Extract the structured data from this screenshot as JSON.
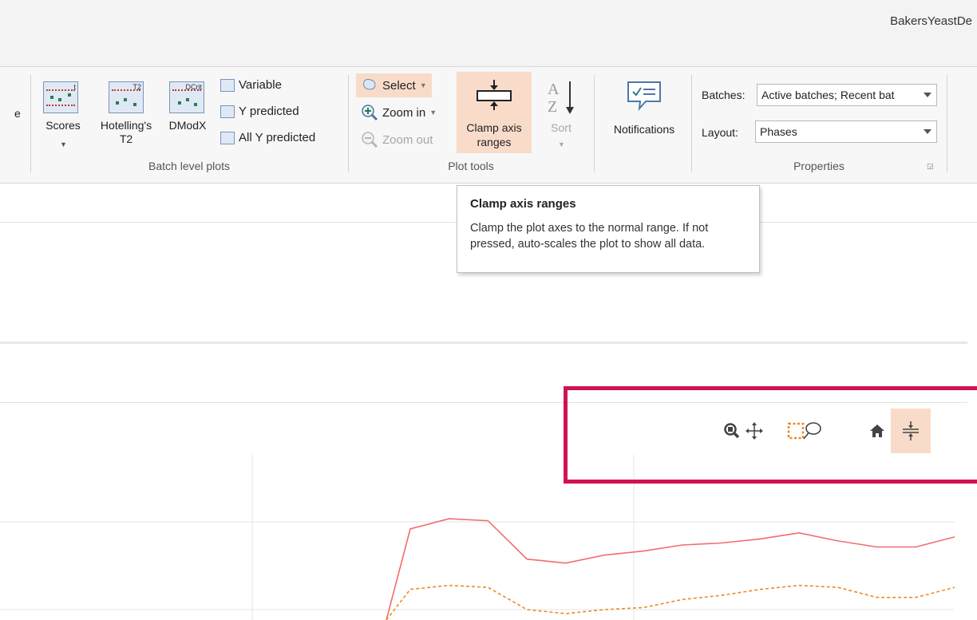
{
  "window": {
    "title": "BakersYeastDe"
  },
  "ribbon": {
    "partial_left_label": "e",
    "batch_level_plots": {
      "label": "Batch level plots",
      "scores": "Scores",
      "hotellings_t2_line1": "Hotelling's",
      "hotellings_t2_line2": "T2",
      "dmodx": "DModX",
      "variable": "Variable",
      "y_predicted": "Y predicted",
      "all_y_predicted": "All Y predicted",
      "icon_tags": {
        "scores": "t",
        "hotellings": "T2",
        "dmodx": "DCrit"
      }
    },
    "plot_tools": {
      "label": "Plot tools",
      "select": "Select",
      "zoom_in": "Zoom in",
      "zoom_out": "Zoom out",
      "clamp_line1": "Clamp axis",
      "clamp_line2": "ranges",
      "sort": "Sort"
    },
    "notifications": {
      "label": "Notifications"
    },
    "properties": {
      "label": "Properties",
      "batches_label": "Batches:",
      "batches_value": "Active batches; Recent bat",
      "layout_label": "Layout:",
      "layout_value": "Phases"
    }
  },
  "tooltip": {
    "title": "Clamp axis ranges",
    "body": "Clamp the plot axes to the normal range. If not pressed, auto-scales the plot to show all data."
  },
  "plot_toolbar": {
    "icons": [
      "zoom-icon",
      "pan-icon",
      "box-select-icon",
      "lasso-select-icon",
      "home-icon",
      "clamp-axis-icon"
    ]
  },
  "colors": {
    "highlight": "#f8dcc9",
    "red_line": "#f26d6d",
    "orange_line": "#f08a24",
    "annotation_red": "#d11450"
  },
  "chart_data": {
    "type": "line",
    "series": [
      {
        "values": [
          6.1,
          6.6,
          6.5,
          4.6,
          4.4,
          4.8,
          5.0,
          5.3,
          5.4,
          5.6,
          5.9,
          5.5,
          5.2,
          5.2,
          5.7
        ]
      },
      {
        "values": [
          3.1,
          3.3,
          3.2,
          2.1,
          1.9,
          2.1,
          2.2,
          2.6,
          2.8,
          3.1,
          3.3,
          3.2,
          2.7,
          2.7,
          3.2
        ]
      }
    ]
  }
}
